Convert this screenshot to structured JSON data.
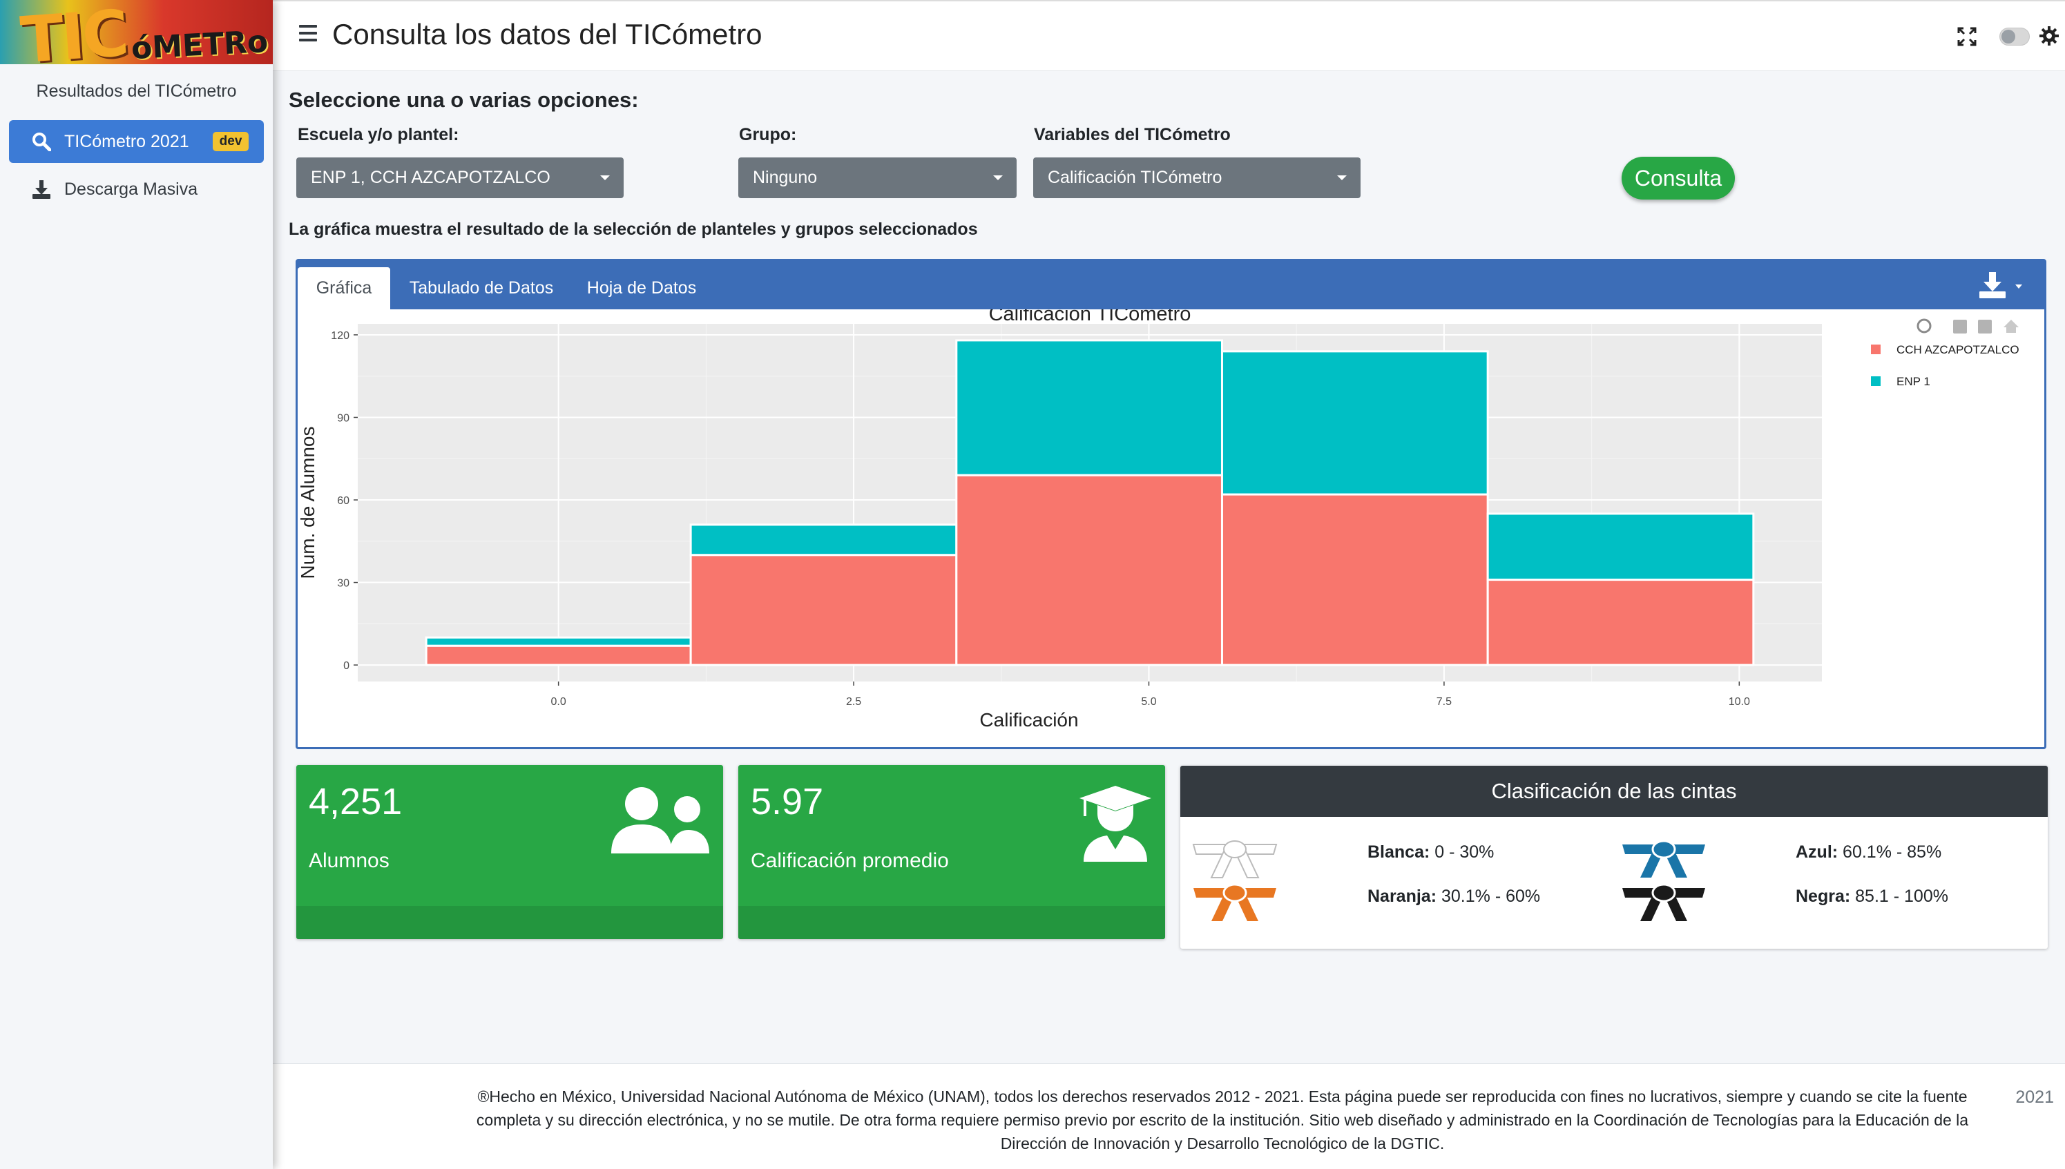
{
  "sidebar": {
    "title": "Resultados del TICómetro",
    "items": [
      {
        "label": "TICómetro 2021",
        "badge": "dev",
        "icon": "search-icon"
      },
      {
        "label": "Descarga Masiva",
        "icon": "download-icon"
      }
    ]
  },
  "logo": {
    "big": "TIC",
    "small": "óMETRo"
  },
  "header": {
    "title": "Consulta los datos del TICómetro"
  },
  "form": {
    "title": "Seleccione una o varias opciones:",
    "escuela_label": "Escuela y/o plantel:",
    "escuela_value": "ENP 1, CCH AZCAPOTZALCO",
    "grupo_label": "Grupo:",
    "grupo_value": "Ninguno",
    "variables_label": "Variables del TICómetro",
    "variables_value": "Calificación TICómetro",
    "submit_label": "Consulta"
  },
  "chart_note": "La gráfica muestra el resultado de la selección de planteles y grupos seleccionados",
  "tabs": [
    {
      "label": "Gráfica"
    },
    {
      "label": "Tabulado de Datos"
    },
    {
      "label": "Hoja de Datos"
    }
  ],
  "colors": {
    "accent": "#3c6db7",
    "cch": "#f8766d",
    "enp": "#00bfc4",
    "green": "#28a745"
  },
  "chart_data": {
    "type": "bar",
    "stacked": true,
    "title": "Calificación TICómetro",
    "xlabel": "Calificación",
    "ylabel": "Num. de Alumnos",
    "x_ticks": [
      "0.0",
      "2.5",
      "5.0",
      "7.5",
      "10.0"
    ],
    "y_ticks": [
      "0",
      "30",
      "60",
      "90",
      "120"
    ],
    "xlim": [
      -1.7,
      10.7
    ],
    "ylim": [
      -6,
      124
    ],
    "bins": [
      {
        "x0": -1.12,
        "x1": 1.12
      },
      {
        "x0": 1.12,
        "x1": 3.37
      },
      {
        "x0": 3.37,
        "x1": 5.62
      },
      {
        "x0": 5.62,
        "x1": 7.87
      },
      {
        "x0": 7.87,
        "x1": 10.12
      }
    ],
    "series": [
      {
        "name": "CCH AZCAPOTZALCO",
        "values": [
          7,
          40,
          69,
          62,
          31
        ]
      },
      {
        "name": "ENP 1",
        "values": [
          3,
          11,
          49,
          52,
          24
        ]
      }
    ],
    "legend_position": "right",
    "grid": true,
    "toolbar": [
      "zoom-icon",
      "zoom-in-icon",
      "zoom-out-icon",
      "home-icon"
    ]
  },
  "stats": [
    {
      "value": "4,251",
      "label": "Alumnos",
      "icon": "users-icon"
    },
    {
      "value": "5.97",
      "label": "Calificación promedio",
      "icon": "graduate-icon"
    }
  ],
  "belts": {
    "title": "Clasificación de las cintas",
    "items": [
      {
        "name": "Blanca:",
        "range": " 0 - 30%",
        "color": "#ffffff"
      },
      {
        "name": "Naranja:",
        "range": " 30.1% - 60%",
        "color": "#e87722"
      },
      {
        "name": "Azul:",
        "range": " 60.1% - 85%",
        "color": "#1a75a8"
      },
      {
        "name": "Negra:",
        "range": " 85.1 - 100%",
        "color": "#1a1a1a"
      }
    ]
  },
  "footer": {
    "text": "®Hecho en México, Universidad Nacional Autónoma de México (UNAM), todos los derechos reservados 2012 - 2021. Esta página puede ser reproducida con fines no lucrativos, siempre y cuando se cite la fuente completa y su dirección electrónica, y no se mutile. De otra forma requiere permiso previo por escrito de la institución. Sitio web diseñado y administrado en la Coordinación de Tecnologías para la Educación de la Dirección de Innovación y Desarrollo Tecnológico de la DGTIC.",
    "year": "2021"
  }
}
